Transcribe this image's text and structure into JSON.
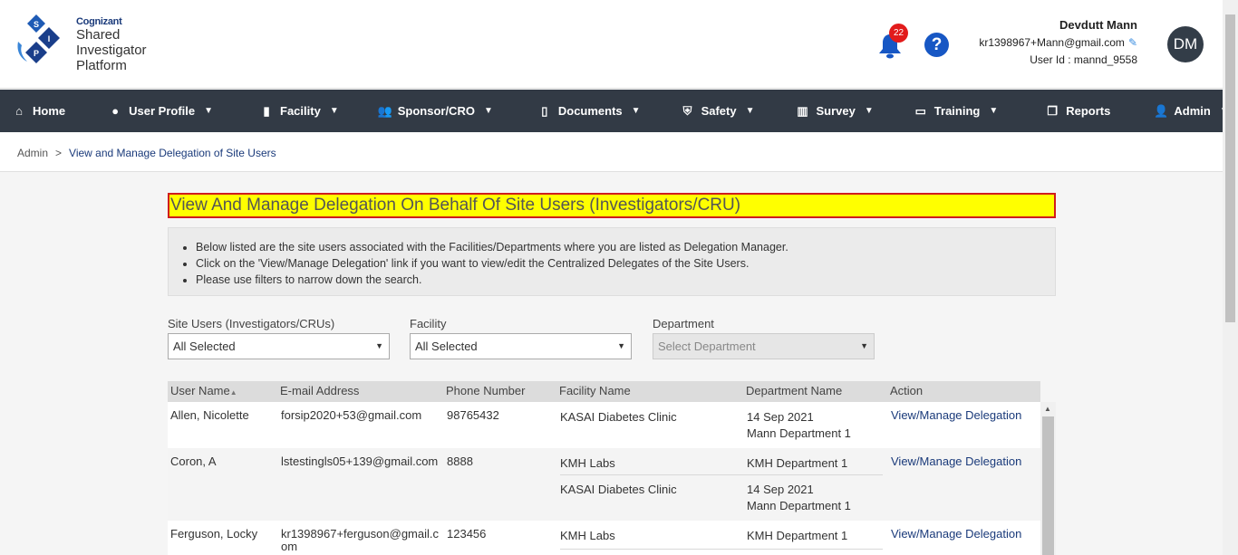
{
  "logo": {
    "brand": "Cognizant",
    "line1": "Shared",
    "line2": "Investigator",
    "line3": "Platform",
    "letters": [
      "S",
      "I",
      "P"
    ]
  },
  "header": {
    "notification_count": "22",
    "help_glyph": "?",
    "user_name": "Devdutt Mann",
    "user_email": "kr1398967+Mann@gmail.com",
    "user_id": "User Id : mannd_9558",
    "avatar_initials": "DM"
  },
  "nav": [
    {
      "label": "Home",
      "icon": "home-icon",
      "dropdown": false
    },
    {
      "label": "User Profile",
      "icon": "user-circle-icon",
      "dropdown": true
    },
    {
      "label": "Facility",
      "icon": "building-icon",
      "dropdown": true
    },
    {
      "label": "Sponsor/CRO",
      "icon": "users-icon",
      "dropdown": true
    },
    {
      "label": "Documents",
      "icon": "file-icon",
      "dropdown": true
    },
    {
      "label": "Safety",
      "icon": "shield-icon",
      "dropdown": true
    },
    {
      "label": "Survey",
      "icon": "bar-chart-icon",
      "dropdown": true
    },
    {
      "label": "Training",
      "icon": "laptop-icon",
      "dropdown": true
    },
    {
      "label": "Reports",
      "icon": "copy-icon",
      "dropdown": false
    },
    {
      "label": "Admin",
      "icon": "user-icon",
      "dropdown": true
    }
  ],
  "breadcrumb": {
    "root": "Admin",
    "separator": ">",
    "current": "View and Manage Delegation of Site Users"
  },
  "page_title": "View And Manage Delegation On Behalf Of Site Users (Investigators/CRU)",
  "instructions": [
    "Below listed are the site users associated with the Facilities/Departments where you are listed as Delegation Manager.",
    "Click on the 'View/Manage Delegation' link if you want to view/edit the Centralized Delegates of the Site Users.",
    "Please use filters to narrow down the search."
  ],
  "filters": {
    "site_users": {
      "label": "Site Users (Investigators/CRUs)",
      "value": "All Selected"
    },
    "facility": {
      "label": "Facility",
      "value": "All Selected"
    },
    "department": {
      "label": "Department",
      "value": "Select Department"
    }
  },
  "table": {
    "headers": [
      "User Name",
      "E-mail Address",
      "Phone Number",
      "Facility Name",
      "Department Name",
      "Action"
    ],
    "rows": [
      {
        "user": "Allen, Nicolette",
        "email": "forsip2020+53@gmail.com",
        "phone": "98765432",
        "facilities": [
          "KASAI Diabetes Clinic"
        ],
        "departments": [
          [
            "14 Sep 2021",
            "Mann Department 1"
          ]
        ],
        "action": "View/Manage Delegation"
      },
      {
        "user": "Coron, A",
        "email": "lstestingls05+139@gmail.com",
        "phone": "8888",
        "facilities": [
          "KMH Labs",
          "KASAI Diabetes Clinic"
        ],
        "departments": [
          [
            "KMH Department 1"
          ],
          [
            "14 Sep 2021",
            "Mann Department 1"
          ]
        ],
        "action": "View/Manage Delegation"
      },
      {
        "user": "Ferguson, Locky",
        "email_line1": "kr1398967+ferguson@gmail.c",
        "email_line2": "om",
        "phone": "123456",
        "facilities": [
          "KMH Labs"
        ],
        "departments": [
          [
            "KMH Department 1"
          ]
        ],
        "action": "View/Manage Delegation"
      }
    ]
  },
  "colors": {
    "nav_bg": "#323a45",
    "title_bg": "#ffff00",
    "title_border": "#d01c1c",
    "link": "#1a3a7a",
    "badge": "#e21b1b",
    "help": "#1757c4"
  }
}
